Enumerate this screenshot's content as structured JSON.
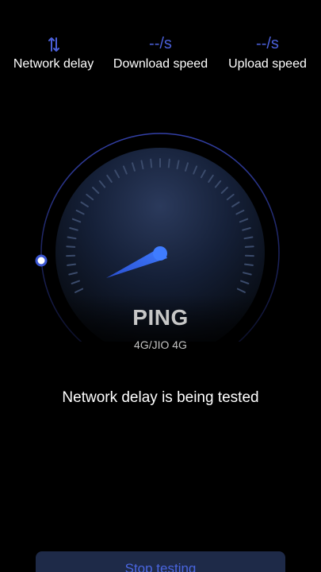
{
  "stats": {
    "delay": {
      "icon": "sort-arrows-icon",
      "label": "Network delay"
    },
    "download": {
      "value": "--/s",
      "label": "Download speed"
    },
    "upload": {
      "value": "--/s",
      "label": "Upload speed"
    }
  },
  "gauge": {
    "label": "PING",
    "network_type": "4G/JIO 4G",
    "accent_color": "#4a66e0"
  },
  "status_text": "Network delay is being tested",
  "stop_button_label": "Stop testing"
}
